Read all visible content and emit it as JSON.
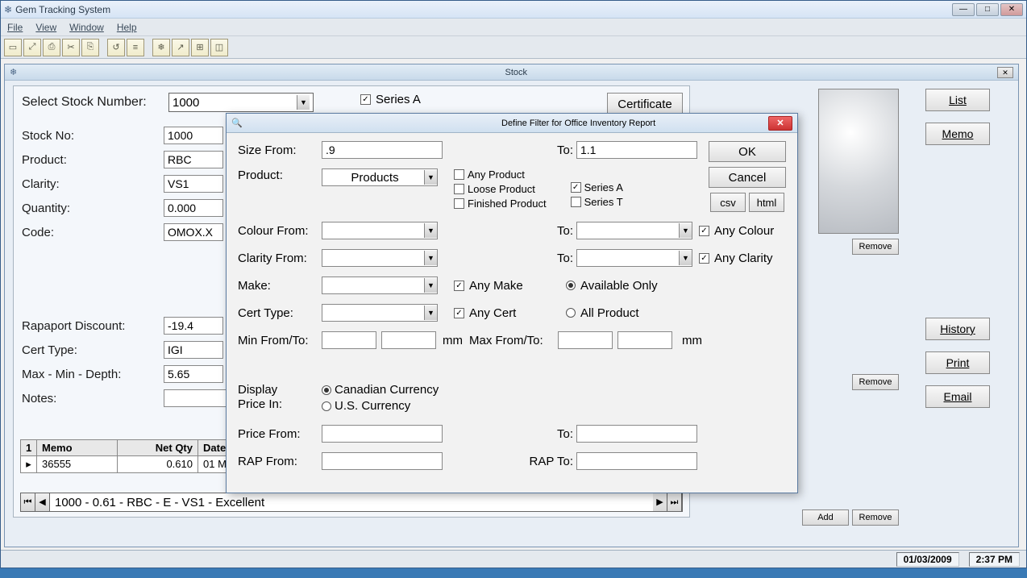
{
  "app": {
    "title": "Gem Tracking System"
  },
  "menu": {
    "file": "File",
    "view": "View",
    "window": "Window",
    "help": "Help"
  },
  "stock": {
    "title": "Stock",
    "selectLabel": "Select Stock Number:",
    "selectValue": "1000",
    "fields": {
      "stockNoLabel": "Stock No:",
      "stockNo": "1000",
      "productLabel": "Product:",
      "product": "RBC",
      "clarityLabel": "Clarity:",
      "clarity": "VS1",
      "quantityLabel": "Quantity:",
      "quantity": "0.000",
      "codeLabel": "Code:",
      "code": "OMOX.X",
      "rapLabel": "Rapaport Discount:",
      "rap": "-19.4",
      "certLabel": "Cert Type:",
      "cert": "IGI",
      "mmdLabel": "Max - Min - Depth:",
      "mmd": "5.65",
      "notesLabel": "Notes:",
      "notes": ""
    },
    "seriesA": "Series A",
    "certificateBtn": "Certificate",
    "grid": {
      "colSel": "1",
      "colMemo": "Memo",
      "colNetQty": "Net Qty",
      "colDate": "Date",
      "rowSel": "▸",
      "memo": "36555",
      "netQty": "0.610",
      "date": "01 M"
    },
    "navText": "1000 - 0.61 - RBC - E - VS1 - Excellent"
  },
  "rightBtns": {
    "list": "List",
    "memo": "Memo",
    "history": "History",
    "print": "Print",
    "email": "Email",
    "add": "Add",
    "remove": "Remove"
  },
  "dialog": {
    "title": "Define Filter for Office Inventory Report",
    "sizeFrom": "Size From:",
    "sizeFromVal": ".9",
    "to": "To:",
    "sizeToVal": "1.1",
    "product": "Product:",
    "productSel": "Products",
    "anyProduct": "Any Product",
    "looseProduct": "Loose Product",
    "finishedProduct": "Finished Product",
    "seriesA": "Series A",
    "seriesT": "Series T",
    "colourFrom": "Colour From:",
    "anyColour": "Any Colour",
    "clarityFrom": "Clarity From:",
    "anyClarity": "Any Clarity",
    "make": "Make:",
    "anyMake": "Any Make",
    "availableOnly": "Available Only",
    "certType": "Cert Type:",
    "anyCert": "Any Cert",
    "allProduct": "All Product",
    "minFromTo": "Min From/To:",
    "maxFromTo": "Max From/To:",
    "mm": "mm",
    "displayPriceIn": "Display Price In:",
    "cadCurrency": "Canadian Currency",
    "usCurrency": "U.S. Currency",
    "priceFrom": "Price From:",
    "rapFrom": "RAP From:",
    "rapTo": "RAP To:",
    "ok": "OK",
    "cancel": "Cancel",
    "csv": "csv",
    "html": "html"
  },
  "status": {
    "date": "01/03/2009",
    "time": "2:37 PM"
  }
}
